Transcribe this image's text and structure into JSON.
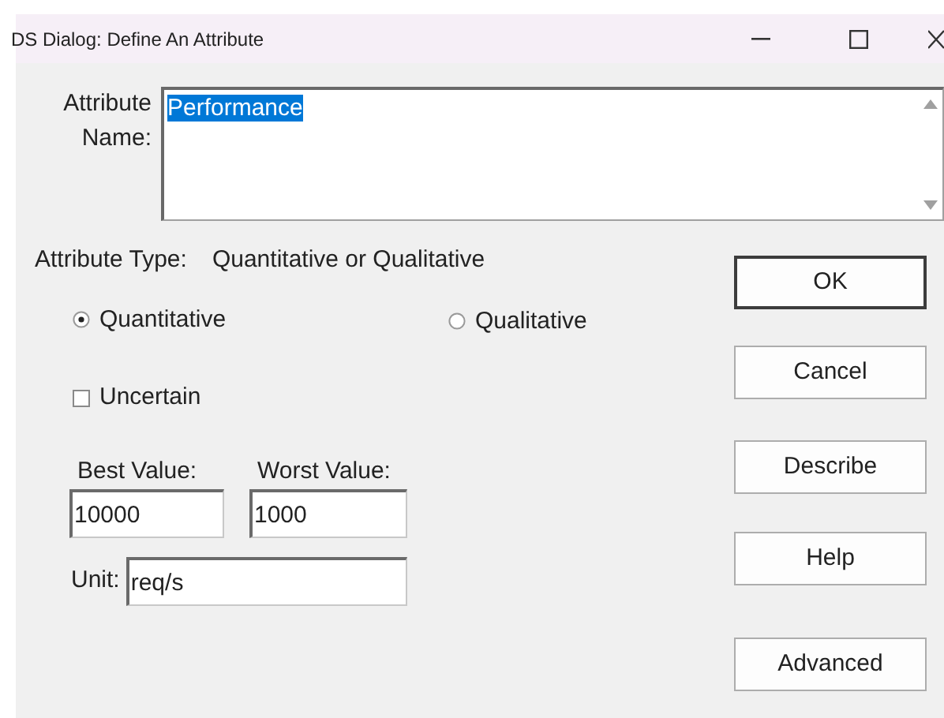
{
  "window": {
    "title": "DS Dialog: Define An Attribute"
  },
  "attribute_name": {
    "label": "Attribute Name:",
    "value": "Performance",
    "selected": true
  },
  "attribute_type": {
    "label": "Attribute Type:",
    "value": "Quantitative or Qualitative"
  },
  "type_options": [
    {
      "label": "Quantitative",
      "selected": true
    },
    {
      "label": "Qualitative",
      "selected": false
    }
  ],
  "uncertain": {
    "label": "Uncertain",
    "checked": false
  },
  "best_value": {
    "label": "Best Value:",
    "value": "10000"
  },
  "worst_value": {
    "label": "Worst Value:",
    "value": "1000"
  },
  "unit": {
    "label": "Unit:",
    "value": "req/s"
  },
  "buttons": [
    {
      "label": "OK",
      "default": true
    },
    {
      "label": "Cancel",
      "default": false
    },
    {
      "label": "Describe",
      "default": false
    },
    {
      "label": "Help",
      "default": false
    },
    {
      "label": "Advanced",
      "default": false
    }
  ]
}
